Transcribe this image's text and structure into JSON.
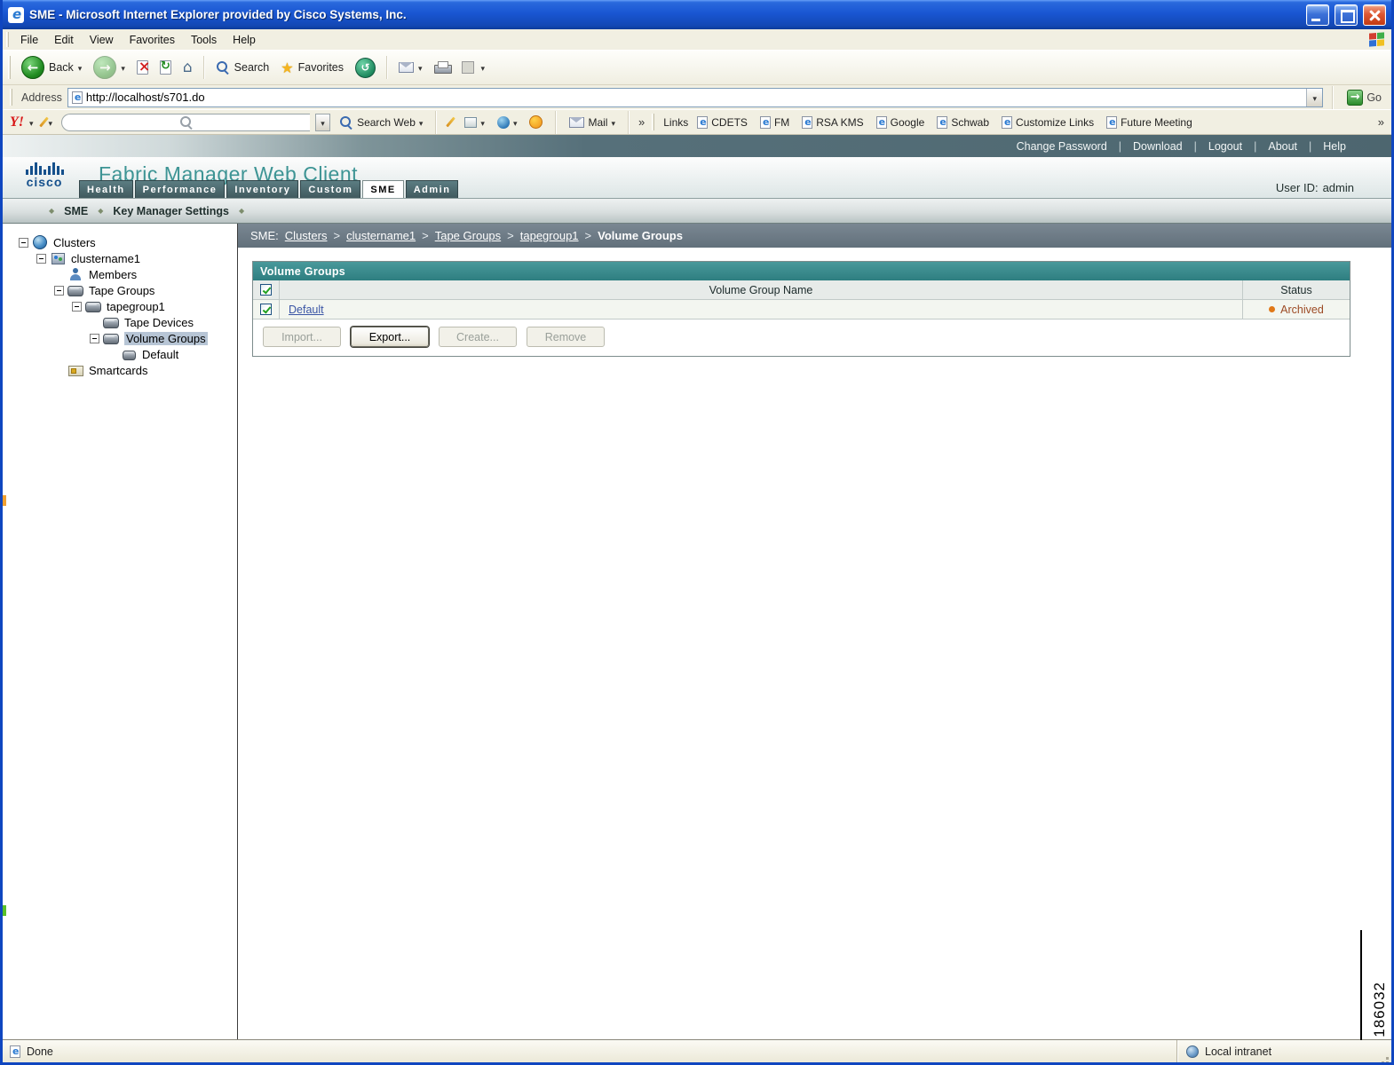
{
  "window": {
    "title": "SME - Microsoft Internet Explorer provided by Cisco Systems, Inc.",
    "status_done": "Done",
    "status_zone": "Local intranet",
    "figure_number": "186032"
  },
  "menu": {
    "items": [
      "File",
      "Edit",
      "View",
      "Favorites",
      "Tools",
      "Help"
    ]
  },
  "toolbar": {
    "back_label": "Back",
    "search_label": "Search",
    "favorites_label": "Favorites"
  },
  "address_bar": {
    "label": "Address",
    "value": "http://localhost/s701.do",
    "go_label": "Go"
  },
  "yahoo": {
    "logo": "Y!",
    "search_web_label": "Search Web",
    "mail_label": "Mail",
    "links_label": "Links",
    "chevron": "»",
    "links": [
      "CDETS",
      "FM",
      "RSA KMS",
      "Google",
      "Schwab",
      "Customize Links",
      "Future Meeting"
    ]
  },
  "header": {
    "utility_links": [
      "Change Password",
      "Download",
      "Logout",
      "About",
      "Help"
    ],
    "pipe": "|",
    "brand": "cisco",
    "title": "Fabric Manager Web Client",
    "tabs": [
      {
        "label": "Health",
        "active": false
      },
      {
        "label": "Performance",
        "active": false
      },
      {
        "label": "Inventory",
        "active": false
      },
      {
        "label": "Custom",
        "active": false
      },
      {
        "label": "SME",
        "active": true
      },
      {
        "label": "Admin",
        "active": false
      }
    ],
    "user_label": "User ID:",
    "user_value": "admin",
    "subnav": [
      "SME",
      "Key Manager Settings"
    ]
  },
  "tree": {
    "items": [
      {
        "label": "Clusters",
        "level": 0,
        "icon": "globe",
        "expanded": true
      },
      {
        "label": "clustername1",
        "level": 1,
        "icon": "cluster",
        "expanded": true
      },
      {
        "label": "Members",
        "level": 2,
        "icon": "members"
      },
      {
        "label": "Tape Groups",
        "level": 2,
        "icon": "tape-group",
        "expanded": true
      },
      {
        "label": "tapegroup1",
        "level": 3,
        "icon": "tape-group",
        "expanded": true
      },
      {
        "label": "Tape Devices",
        "level": 4,
        "icon": "tape-group"
      },
      {
        "label": "Volume Groups",
        "level": 4,
        "icon": "tape-group",
        "expanded": true,
        "selected": true
      },
      {
        "label": "Default",
        "level": 5,
        "icon": "volume"
      },
      {
        "label": "Smartcards",
        "level": 2,
        "icon": "smartcard"
      }
    ]
  },
  "breadcrumb": {
    "prefix": "SME:",
    "separator": ">",
    "links": [
      "Clusters",
      "clustername1",
      "Tape Groups",
      "tapegroup1"
    ],
    "current": "Volume Groups"
  },
  "panel": {
    "title": "Volume Groups",
    "columns": {
      "name": "Volume Group Name",
      "status": "Status"
    },
    "rows": [
      {
        "name": "Default",
        "status": "Archived",
        "checked": true
      }
    ],
    "buttons": [
      {
        "label": "Import...",
        "enabled": false
      },
      {
        "label": "Export...",
        "enabled": true
      },
      {
        "label": "Create...",
        "enabled": false
      },
      {
        "label": "Remove",
        "enabled": false
      }
    ]
  },
  "colors": {
    "titlebar_blue": "#1a57d0",
    "app_title_teal": "#3d9494",
    "panel_header_teal": "#35888a",
    "breadcrumb_slate": "#6e7c87",
    "selection": "#b7c5d5",
    "link_blue": "#3a55a5",
    "archived_text": "#9c4a24",
    "archived_dot": "#e07818",
    "yahoo_red": "#d81616"
  }
}
